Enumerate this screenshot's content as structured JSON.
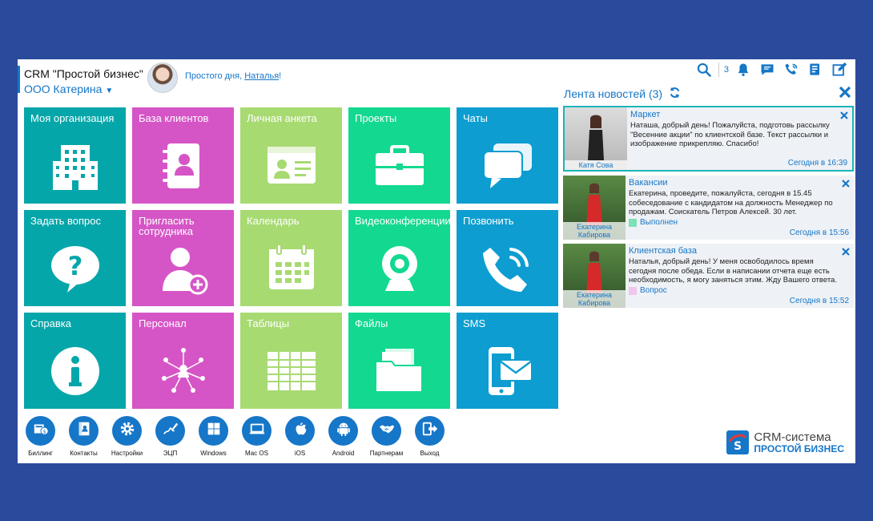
{
  "header": {
    "crm_title": "CRM \"Простой бизнес\"",
    "org_name": "ООО Катерина",
    "greeting_prefix": "Простого дня, ",
    "greeting_name": "Наталья",
    "greeting_suffix": "!",
    "notification_count": "3"
  },
  "tiles": [
    {
      "label": "Моя организация",
      "color": "#05a6a9",
      "icon": "building-icon"
    },
    {
      "label": "База клиентов",
      "color": "#d655c6",
      "icon": "contacts-book-icon"
    },
    {
      "label": "Личная анкета",
      "color": "#a8da72",
      "icon": "id-card-icon"
    },
    {
      "label": "Проекты",
      "color": "#12d98f",
      "icon": "briefcase-icon"
    },
    {
      "label": "Чаты",
      "color": "#0e9dd0",
      "icon": "chat-icon"
    },
    {
      "label": "Задать вопрос",
      "color": "#05a6a9",
      "icon": "question-bubble-icon"
    },
    {
      "label": "Пригласить",
      "label2": "сотрудника",
      "color": "#d655c6",
      "icon": "add-user-icon"
    },
    {
      "label": "Календарь",
      "color": "#a8da72",
      "icon": "calendar-icon"
    },
    {
      "label": "Видеоконференции",
      "color": "#12d98f",
      "icon": "webcam-icon"
    },
    {
      "label": "Позвонить",
      "color": "#0e9dd0",
      "icon": "phone-icon"
    },
    {
      "label": "Справка",
      "color": "#05a6a9",
      "icon": "info-icon"
    },
    {
      "label": "Персонал",
      "color": "#d655c6",
      "icon": "org-chart-icon"
    },
    {
      "label": "Таблицы",
      "color": "#a8da72",
      "icon": "table-icon"
    },
    {
      "label": "Файлы",
      "color": "#12d98f",
      "icon": "folder-icon"
    },
    {
      "label": "SMS",
      "color": "#0e9dd0",
      "icon": "sms-phone-icon"
    }
  ],
  "bottom_bar": [
    {
      "label": "Биллинг",
      "icon": "billing-icon"
    },
    {
      "label": "Контакты",
      "icon": "contacts-icon"
    },
    {
      "label": "Настройки",
      "icon": "settings-icon"
    },
    {
      "label": "ЭЦП",
      "icon": "signature-icon"
    },
    {
      "label": "Windows",
      "icon": "windows-icon"
    },
    {
      "label": "Mac OS",
      "icon": "macos-icon"
    },
    {
      "label": "iOS",
      "icon": "apple-icon"
    },
    {
      "label": "Android",
      "icon": "android-icon"
    },
    {
      "label": "Партнерам",
      "icon": "handshake-icon"
    },
    {
      "label": "Выход",
      "icon": "exit-icon"
    }
  ],
  "logo": {
    "line1": "CRM-система",
    "line2": "ПРОСТОЙ БИЗНЕС"
  },
  "feed": {
    "title": "Лента новостей (3)",
    "items": [
      {
        "category": "Маркет",
        "author": "Катя Сова",
        "text": "Наташа, добрый день! Пожалуйста, подготовь рассылку \"Весенние акции\" по клиентской базе. Текст рассылки и изображение прикрепляю. Спасибо!",
        "status": "",
        "time": "Сегодня в 16:39"
      },
      {
        "category": "Вакансии",
        "author": "Екатерина Кабирова",
        "text": "Екатерина, проведите, пожалуйста, сегодня в 15.45 собеседование с кандидатом на должность Менеджер по продажам. Соискатель Петров Алексей. 30 лет.",
        "status": "Выполнен",
        "status_color": "#7ee0b6",
        "time": "Сегодня в 15:56"
      },
      {
        "category": "Клиентская база",
        "author": "Екатерина Кабирова",
        "text": "Наталья, добрый день! У меня освободилось время сегодня после обеда. Если в написании отчета еще есть необходимость, я могу заняться этим. Жду Вашего ответа.",
        "status": "Вопрос",
        "status_color": "#f0c6ec",
        "time": "Сегодня в 15:52"
      }
    ]
  },
  "colors": {
    "accent": "#1676c8",
    "background": "#2a4a9c"
  }
}
